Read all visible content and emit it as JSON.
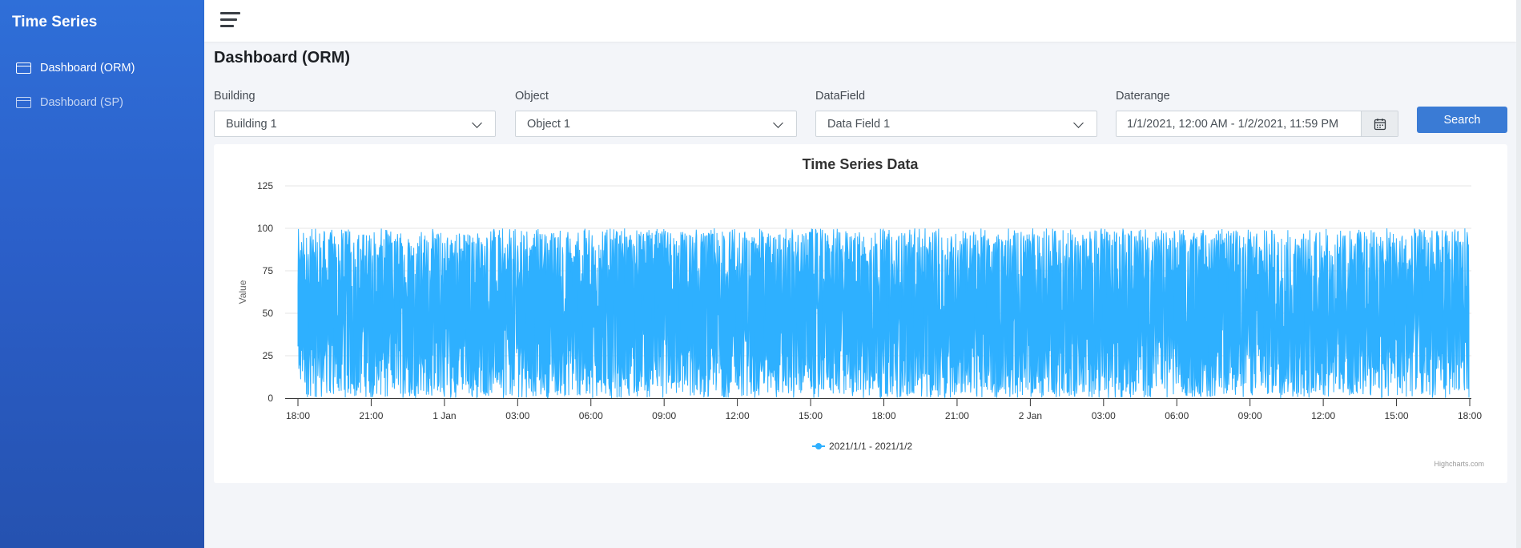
{
  "sidebar": {
    "brand": "Time Series",
    "items": [
      {
        "label": "Dashboard (ORM)",
        "active": true
      },
      {
        "label": "Dashboard (SP)",
        "active": false
      }
    ]
  },
  "page": {
    "title": "Dashboard (ORM)"
  },
  "filters": {
    "building": {
      "label": "Building",
      "value": "Building 1"
    },
    "object": {
      "label": "Object",
      "value": "Object 1"
    },
    "datafield": {
      "label": "DataField",
      "value": "Data Field 1"
    },
    "daterange": {
      "label": "Daterange",
      "value": "1/1/2021, 12:00 AM - 1/2/2021, 11:59 PM"
    },
    "search_label": "Search"
  },
  "chart_data": {
    "type": "area",
    "title": "Time Series Data",
    "ylabel": "Value",
    "xlabel": "",
    "ylim": [
      0,
      125
    ],
    "yticks": [
      0,
      25,
      50,
      75,
      100,
      125
    ],
    "xlim": [
      "2020-12-31 18:00",
      "2021-01-02 18:00"
    ],
    "xtick_labels": [
      "18:00",
      "21:00",
      "1 Jan",
      "03:00",
      "06:00",
      "09:00",
      "12:00",
      "15:00",
      "18:00",
      "21:00",
      "2 Jan",
      "03:00",
      "06:00",
      "09:00",
      "12:00",
      "15:00",
      "18:00"
    ],
    "series": [
      {
        "name": "2021/1/1 - 2021/1/2",
        "color": "#2eb0ff",
        "value_range": [
          0,
          100
        ],
        "pattern": "dense random noise between 0 and 100"
      }
    ],
    "legend": "bottom-center",
    "grid": true,
    "credits": "Highcharts.com"
  }
}
